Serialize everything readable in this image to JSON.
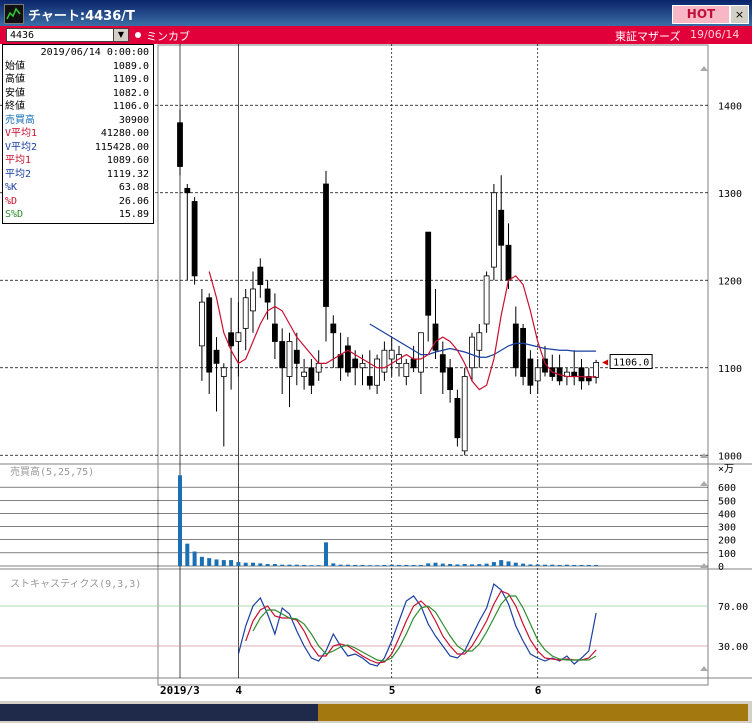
{
  "window": {
    "title": "チャート:4436/T",
    "hot_label": "HOT",
    "close_label": "×"
  },
  "toolbar": {
    "code": "4436",
    "chart_kind": "ミンカブ",
    "market": "東証マザーズ",
    "date": "19/06/14"
  },
  "info_panel": {
    "rows": [
      {
        "label": "",
        "value": "2019/06/14 0:00:00",
        "color": "#000000"
      },
      {
        "label": "始値",
        "value": "1089.0",
        "color": "#000000"
      },
      {
        "label": "高値",
        "value": "1109.0",
        "color": "#000000"
      },
      {
        "label": "安値",
        "value": "1082.0",
        "color": "#000000"
      },
      {
        "label": "終値",
        "value": "1106.0",
        "color": "#000000"
      },
      {
        "label": "売買高",
        "value": "30900",
        "color": "#1a6fb5"
      },
      {
        "label": "V平均1",
        "value": "41280.00",
        "color": "#c8102e"
      },
      {
        "label": "V平均2",
        "value": "115428.00",
        "color": "#1a3fa0"
      },
      {
        "label": "平均1",
        "value": "1089.60",
        "color": "#c8102e"
      },
      {
        "label": "平均2",
        "value": "1119.32",
        "color": "#1a3fa0"
      },
      {
        "label": "%K",
        "value": "63.08",
        "color": "#1a3fa0"
      },
      {
        "label": "%D",
        "value": "26.06",
        "color": "#c8102e"
      },
      {
        "label": "S%D",
        "value": "15.89",
        "color": "#2e8b2e"
      }
    ]
  },
  "colors": {
    "up": "#ffffff",
    "down": "#000000",
    "ma_short": "#c8102e",
    "ma_long": "#1a3fa0",
    "volume": "#1a6fb5",
    "stoch_k": "#1a3fa0",
    "stoch_d": "#c8102e",
    "stoch_sd": "#2e8b2e"
  },
  "chart_data": [
    {
      "type": "candlestick",
      "price_ticks": [
        1400,
        1300,
        1200,
        1100,
        1000
      ],
      "ylim": [
        990,
        1470
      ],
      "last_price_label": "1106.0",
      "x_labels": [
        {
          "label": "2019/3",
          "index": 0
        },
        {
          "label": "4",
          "index": 8
        },
        {
          "label": "5",
          "index": 29
        },
        {
          "label": "6",
          "index": 49
        }
      ],
      "candles": [
        [
          1380,
          1395,
          1320,
          1330
        ],
        [
          1305,
          1310,
          1200,
          1300
        ],
        [
          1290,
          1295,
          1195,
          1205
        ],
        [
          1125,
          1190,
          1085,
          1175
        ],
        [
          1180,
          1185,
          1070,
          1095
        ],
        [
          1120,
          1135,
          1050,
          1105
        ],
        [
          1090,
          1105,
          1010,
          1100
        ],
        [
          1140,
          1180,
          1075,
          1125
        ],
        [
          1130,
          1175,
          1090,
          1140
        ],
        [
          1145,
          1190,
          1120,
          1180
        ],
        [
          1165,
          1210,
          1140,
          1190
        ],
        [
          1215,
          1225,
          1180,
          1195
        ],
        [
          1190,
          1200,
          1155,
          1175
        ],
        [
          1150,
          1185,
          1110,
          1130
        ],
        [
          1130,
          1145,
          1070,
          1100
        ],
        [
          1090,
          1140,
          1055,
          1130
        ],
        [
          1120,
          1140,
          1080,
          1105
        ],
        [
          1090,
          1110,
          1075,
          1095
        ],
        [
          1100,
          1110,
          1070,
          1080
        ],
        [
          1095,
          1120,
          1085,
          1105
        ],
        [
          1310,
          1325,
          1130,
          1170
        ],
        [
          1150,
          1160,
          1100,
          1140
        ],
        [
          1115,
          1140,
          1085,
          1100
        ],
        [
          1125,
          1135,
          1090,
          1095
        ],
        [
          1110,
          1120,
          1080,
          1100
        ],
        [
          1100,
          1115,
          1080,
          1105
        ],
        [
          1090,
          1120,
          1075,
          1080
        ],
        [
          1080,
          1115,
          1070,
          1110
        ],
        [
          1095,
          1130,
          1085,
          1120
        ],
        [
          1110,
          1135,
          1090,
          1120
        ],
        [
          1105,
          1125,
          1090,
          1115
        ],
        [
          1090,
          1110,
          1080,
          1105
        ],
        [
          1110,
          1125,
          1095,
          1100
        ],
        [
          1095,
          1140,
          1070,
          1140
        ],
        [
          1255,
          1255,
          1130,
          1160
        ],
        [
          1150,
          1190,
          1110,
          1120
        ],
        [
          1115,
          1130,
          1070,
          1095
        ],
        [
          1100,
          1110,
          1060,
          1075
        ],
        [
          1065,
          1075,
          1010,
          1020
        ],
        [
          1005,
          1100,
          1000,
          1090
        ],
        [
          1100,
          1140,
          1085,
          1135
        ],
        [
          1120,
          1150,
          1100,
          1140
        ],
        [
          1150,
          1210,
          1140,
          1205
        ],
        [
          1215,
          1310,
          1200,
          1300
        ],
        [
          1280,
          1320,
          1200,
          1240
        ],
        [
          1240,
          1265,
          1190,
          1200
        ],
        [
          1150,
          1170,
          1090,
          1100
        ],
        [
          1145,
          1150,
          1080,
          1090
        ],
        [
          1110,
          1120,
          1070,
          1080
        ],
        [
          1085,
          1110,
          1070,
          1100
        ],
        [
          1110,
          1125,
          1090,
          1095
        ],
        [
          1100,
          1115,
          1085,
          1090
        ],
        [
          1100,
          1115,
          1080,
          1085
        ],
        [
          1090,
          1100,
          1080,
          1095
        ],
        [
          1095,
          1120,
          1080,
          1090
        ],
        [
          1100,
          1110,
          1075,
          1085
        ],
        [
          1090,
          1100,
          1080,
          1085
        ],
        [
          1089,
          1109,
          1082,
          1106
        ]
      ],
      "ma_short": [
        null,
        null,
        null,
        null,
        1210,
        1180,
        1140,
        1120,
        1105,
        1110,
        1130,
        1150,
        1165,
        1170,
        1165,
        1150,
        1135,
        1125,
        1115,
        1105,
        1105,
        1110,
        1115,
        1120,
        1115,
        1110,
        1105,
        1100,
        1100,
        1105,
        1110,
        1115,
        1110,
        1110,
        1115,
        1130,
        1135,
        1130,
        1120,
        1105,
        1085,
        1075,
        1080,
        1110,
        1160,
        1200,
        1205,
        1195,
        1165,
        1130,
        1105,
        1095,
        1092,
        1090,
        1090,
        1090,
        1089,
        1090
      ],
      "ma_long": [
        null,
        null,
        null,
        null,
        null,
        null,
        null,
        null,
        null,
        null,
        null,
        null,
        null,
        null,
        null,
        null,
        null,
        null,
        null,
        null,
        null,
        null,
        null,
        null,
        null,
        null,
        1150,
        1145,
        1140,
        1135,
        1130,
        1125,
        1120,
        1115,
        1115,
        1118,
        1120,
        1122,
        1120,
        1118,
        1115,
        1112,
        1112,
        1115,
        1120,
        1125,
        1128,
        1128,
        1126,
        1124,
        1122,
        1121,
        1120,
        1120,
        1119,
        1119,
        1119,
        1119
      ]
    },
    {
      "type": "bar",
      "title": "売買高(5,25,75)",
      "y_unit": "×万",
      "y_ticks": [
        600,
        500,
        400,
        300,
        200,
        100,
        0
      ],
      "ylim": [
        0,
        700
      ],
      "values": [
        690,
        170,
        110,
        70,
        60,
        50,
        45,
        45,
        30,
        25,
        25,
        20,
        15,
        15,
        10,
        10,
        10,
        8,
        6,
        6,
        180,
        20,
        10,
        10,
        8,
        8,
        6,
        6,
        8,
        10,
        8,
        8,
        8,
        8,
        20,
        25,
        18,
        15,
        12,
        15,
        12,
        14,
        18,
        30,
        45,
        35,
        25,
        18,
        12,
        12,
        10,
        10,
        8,
        10,
        8,
        8,
        8,
        8
      ]
    },
    {
      "type": "line",
      "title": "ストキャスティクス(9,3,3)",
      "y_ticks": [
        70,
        30
      ],
      "ylim": [
        0,
        100
      ],
      "series": [
        {
          "name": "%K",
          "values": [
            null,
            null,
            null,
            null,
            null,
            null,
            null,
            null,
            22,
            50,
            70,
            78,
            62,
            42,
            68,
            62,
            45,
            30,
            18,
            15,
            25,
            42,
            30,
            20,
            22,
            18,
            12,
            10,
            18,
            35,
            55,
            75,
            80,
            70,
            52,
            40,
            30,
            20,
            18,
            25,
            40,
            55,
            68,
            92,
            86,
            72,
            50,
            35,
            22,
            18,
            15,
            18,
            15,
            20,
            12,
            18,
            25,
            63
          ]
        },
        {
          "name": "%D",
          "values": [
            null,
            null,
            null,
            null,
            null,
            null,
            null,
            null,
            null,
            35,
            55,
            66,
            70,
            60,
            58,
            58,
            56,
            45,
            30,
            20,
            20,
            30,
            32,
            30,
            25,
            20,
            16,
            13,
            14,
            22,
            38,
            55,
            70,
            75,
            68,
            55,
            40,
            30,
            22,
            22,
            30,
            42,
            55,
            72,
            85,
            82,
            70,
            52,
            36,
            25,
            18,
            17,
            16,
            17,
            16,
            16,
            18,
            26
          ]
        },
        {
          "name": "S%D",
          "values": [
            null,
            null,
            null,
            null,
            null,
            null,
            null,
            null,
            null,
            null,
            45,
            58,
            66,
            66,
            62,
            58,
            57,
            52,
            42,
            30,
            22,
            25,
            29,
            31,
            28,
            24,
            20,
            16,
            15,
            18,
            28,
            42,
            58,
            68,
            70,
            64,
            52,
            40,
            30,
            25,
            25,
            32,
            44,
            58,
            72,
            80,
            80,
            68,
            52,
            36,
            26,
            20,
            17,
            16,
            16,
            16,
            16,
            20
          ]
        }
      ]
    }
  ]
}
